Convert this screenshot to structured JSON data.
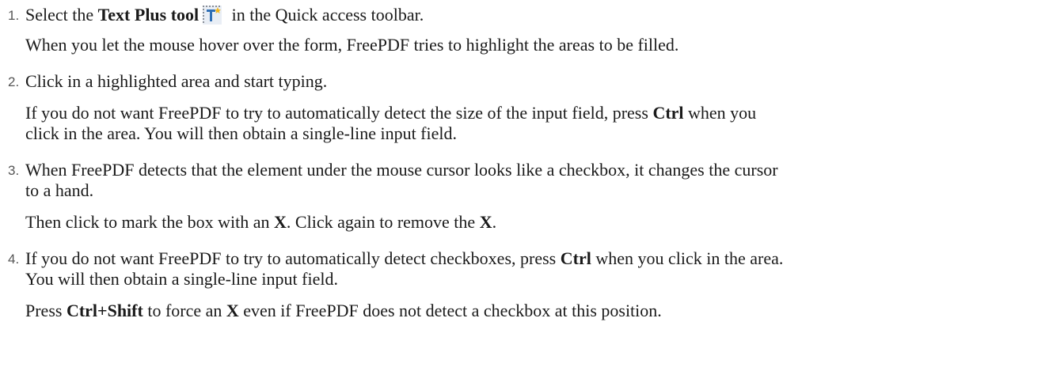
{
  "steps": [
    {
      "number": "1.",
      "main": {
        "t1": "Select the ",
        "b1": "Text Plus tool",
        "icon": "text-plus-tool-icon",
        "t2": " in the Quick access toolbar."
      },
      "notes": [
        "When you let the mouse hover over the form, FreePDF tries to highlight the areas to be filled."
      ]
    },
    {
      "number": "2.",
      "main": {
        "t1": "Click in a highlighted area and start typing."
      },
      "note": {
        "t1": "If you do not want FreePDF to try to automatically detect the size of the input field, press ",
        "b1": "Ctrl",
        "t2": " when you",
        "t3": "click in the area. You will then obtain a single-line input field."
      }
    },
    {
      "number": "3.",
      "main": {
        "t1": "When FreePDF detects that the element under the mouse cursor looks like a checkbox, it changes the cursor",
        "t2": "to a hand."
      },
      "note": {
        "t1": "Then click to mark the box with an ",
        "b1": "X",
        "t2": ". Click again to remove the ",
        "b2": "X",
        "t3": "."
      }
    },
    {
      "number": "4.",
      "main": {
        "t1": "If you do not want FreePDF to try to automatically detect checkboxes, press ",
        "b1": "Ctrl",
        "t2": " when you click in the area.",
        "t3": "You will then obtain a single-line input field."
      },
      "note": {
        "t1": "Press ",
        "b1": "Ctrl+Shift",
        "t2": " to force an ",
        "b2": "X",
        "t3": " even if FreePDF does not detect a checkbox at this position."
      }
    }
  ]
}
